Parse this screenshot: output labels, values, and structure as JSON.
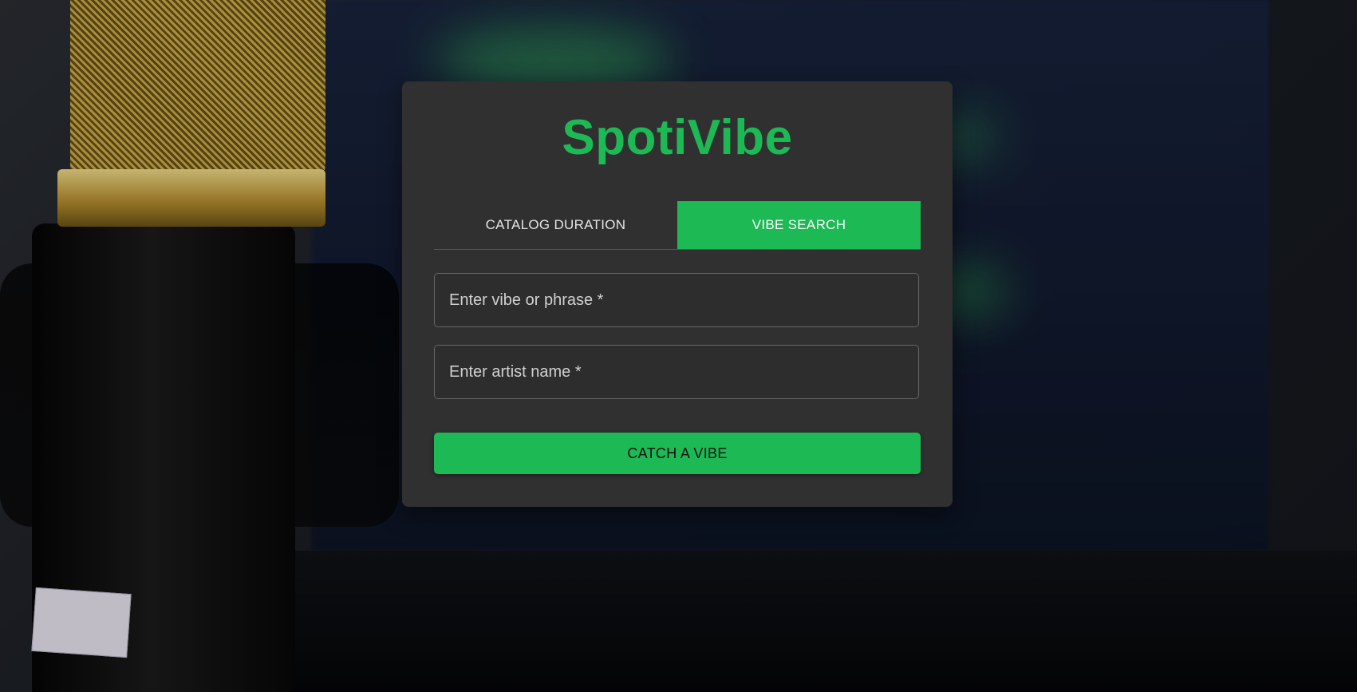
{
  "app": {
    "title": "SpotiVibe"
  },
  "tabs": [
    {
      "label": "CATALOG DURATION",
      "active": false
    },
    {
      "label": "VIBE SEARCH",
      "active": true
    }
  ],
  "form": {
    "vibe_placeholder": "Enter vibe or phrase *",
    "artist_placeholder": "Enter artist name *",
    "submit_label": "CATCH A VIBE"
  },
  "theme": {
    "accent": "#1db954",
    "card_bg": "#303030"
  }
}
